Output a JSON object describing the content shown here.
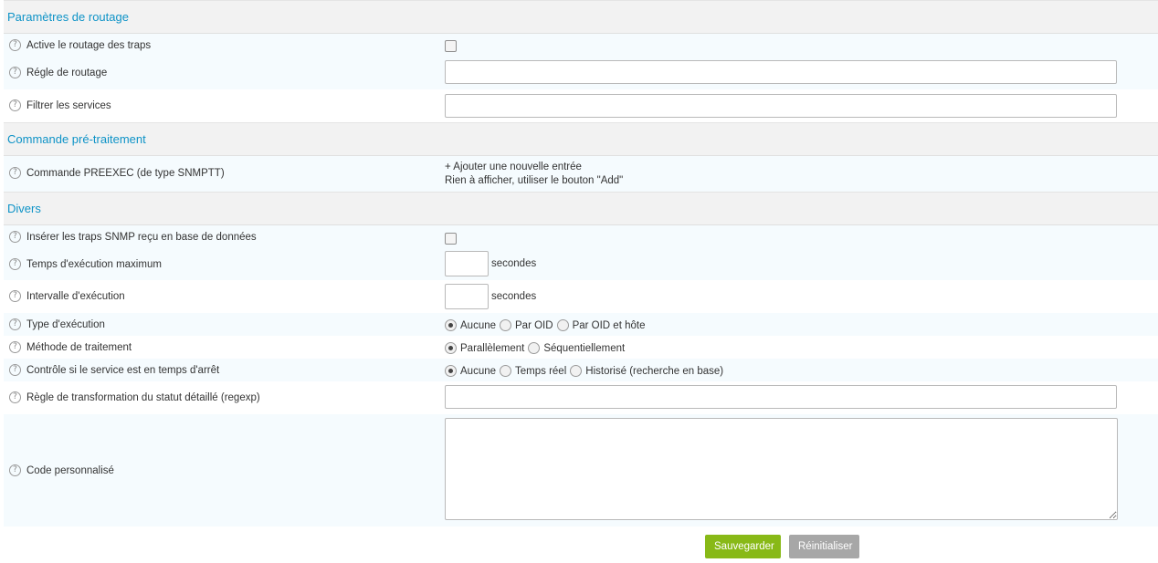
{
  "sections": {
    "routing": "Paramètres de routage",
    "preexec": "Commande pré-traitement",
    "misc": "Divers"
  },
  "fields": {
    "enable_routing": {
      "label": "Active le routage des traps",
      "checked": false
    },
    "routing_rule": {
      "label": "Régle de routage",
      "value": ""
    },
    "filter_services": {
      "label": "Filtrer les services",
      "value": ""
    },
    "preexec_command": {
      "label": "Commande PREEXEC (de type SNMPTT)",
      "add_link": "+ Ajouter une nouvelle entrée",
      "empty_text": "Rien à afficher, utiliser le bouton \"Add\""
    },
    "insert_traps": {
      "label": "Insérer les traps SNMP reçu en base de données",
      "checked": false
    },
    "max_exec_time": {
      "label": "Temps d'exécution maximum",
      "value": "",
      "unit": "secondes"
    },
    "exec_interval": {
      "label": "Intervalle d'exécution",
      "value": "",
      "unit": "secondes"
    },
    "exec_type": {
      "label": "Type d'exécution",
      "options": [
        "Aucune",
        "Par OID",
        "Par OID et hôte"
      ],
      "selected": "Aucune"
    },
    "processing_method": {
      "label": "Méthode de traitement",
      "options": [
        "Parallèlement",
        "Séquentiellement"
      ],
      "selected": "Parallèlement"
    },
    "downtime_check": {
      "label": "Contrôle si le service est en temps d'arrêt",
      "options": [
        "Aucune",
        "Temps réel",
        "Historisé (recherche en base)"
      ],
      "selected": "Aucune"
    },
    "status_regexp": {
      "label": "Règle de transformation du statut détaillé (regexp)",
      "value": ""
    },
    "custom_code": {
      "label": "Code personnalisé",
      "value": ""
    }
  },
  "icons": {
    "help": "?"
  },
  "buttons": {
    "save": "Sauvegarder",
    "reset": "Réinitialiser"
  },
  "colors": {
    "section_title": "#0e93c7",
    "save_button": "#88b917",
    "reset_button": "#a7a7a7",
    "row_alt": "#f5fbfe"
  }
}
